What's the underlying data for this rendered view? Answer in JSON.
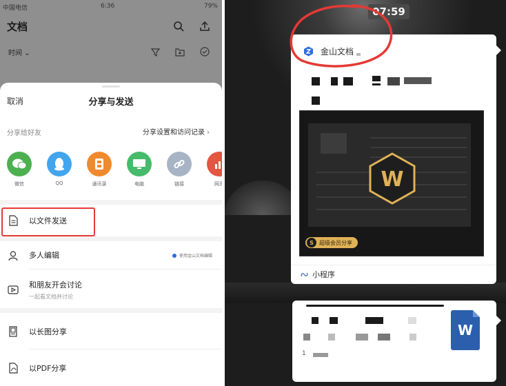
{
  "left_phone": {
    "status": {
      "carrier": "中国电信",
      "time": "6:36",
      "battery": "79%"
    },
    "app_title": "文档",
    "sort_label": "时间",
    "icons": {
      "search": "search-icon",
      "upload": "upload-icon"
    },
    "sheet": {
      "cancel": "取消",
      "title": "分享与发送",
      "share_to_friends": "分享给好友",
      "share_settings": "分享设置和访问记录",
      "apps": [
        {
          "label": "微信",
          "color": "#4cb050",
          "icon": "wechat-icon"
        },
        {
          "label": "QQ",
          "color": "#43a5ee",
          "icon": "qq-icon"
        },
        {
          "label": "通讯录",
          "color": "#f08a2e",
          "icon": "contacts-icon"
        },
        {
          "label": "电脑",
          "color": "#46bb6b",
          "icon": "computer-icon"
        },
        {
          "label": "链接",
          "color": "#a7b4c5",
          "icon": "link-icon"
        },
        {
          "label": "网页",
          "color": "#e45543",
          "icon": "web-icon"
        }
      ],
      "rows": {
        "send_as_file": "以文件发送",
        "multi_edit": "多人编辑",
        "multi_edit_badge": "使用金山文档编辑",
        "discuss": "和朋友开会讨论",
        "discuss_sub": "一起看文档并讨论",
        "long_image": "以长图分享",
        "pdf_share": "以PDF分享"
      }
    }
  },
  "right_phone": {
    "time": "07:59",
    "card": {
      "brand": "金山文档",
      "premium_badge": "超级会员分享",
      "premium_glyph": "S",
      "thumb_glyph": "W",
      "mini_program": "小程序"
    },
    "file_card": {
      "word_glyph": "W",
      "size_text": "1"
    }
  },
  "colors": {
    "highlight_red": "#e53935",
    "wps_gold": "#e0b257",
    "word_blue": "#2b5fae"
  }
}
